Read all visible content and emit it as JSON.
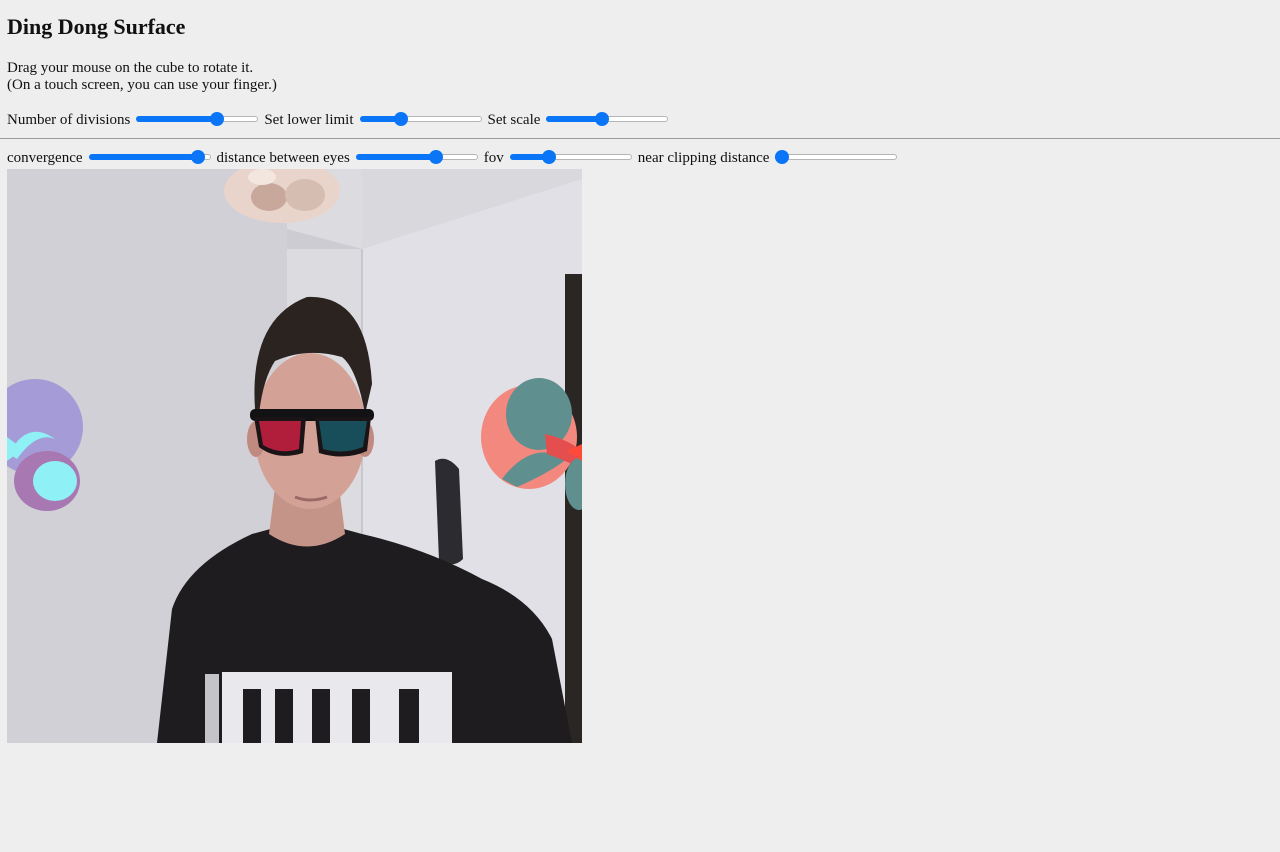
{
  "page": {
    "title": "Ding Dong Surface",
    "instructions": [
      "Drag your mouse on the cube to rotate it.",
      "(On a touch screen, you can use your finger.)"
    ]
  },
  "controls_row1": [
    {
      "label": "Number of divisions",
      "value_fraction": 0.68
    },
    {
      "label": "Set lower limit",
      "value_fraction": 0.32
    },
    {
      "label": "Set scale",
      "value_fraction": 0.45
    }
  ],
  "controls_row2": [
    {
      "label": "convergence",
      "value_fraction": 0.95
    },
    {
      "label": "distance between eyes",
      "value_fraction": 0.68
    },
    {
      "label": "fov",
      "value_fraction": 0.3
    },
    {
      "label": "near clipping distance",
      "value_fraction": 0.0
    }
  ],
  "colors": {
    "background": "#eeeeee",
    "slider_accent": "#0a75f7",
    "surface_left_lavender": "#a59bd6",
    "surface_left_cyan": "#8ff0f6",
    "surface_left_purple": "#a778b2",
    "surface_right_salmon": "#f2887e",
    "surface_right_teal": "#5f8f8e"
  },
  "scene": {
    "type": "webcam-feed-with-anaglyph-surface"
  }
}
